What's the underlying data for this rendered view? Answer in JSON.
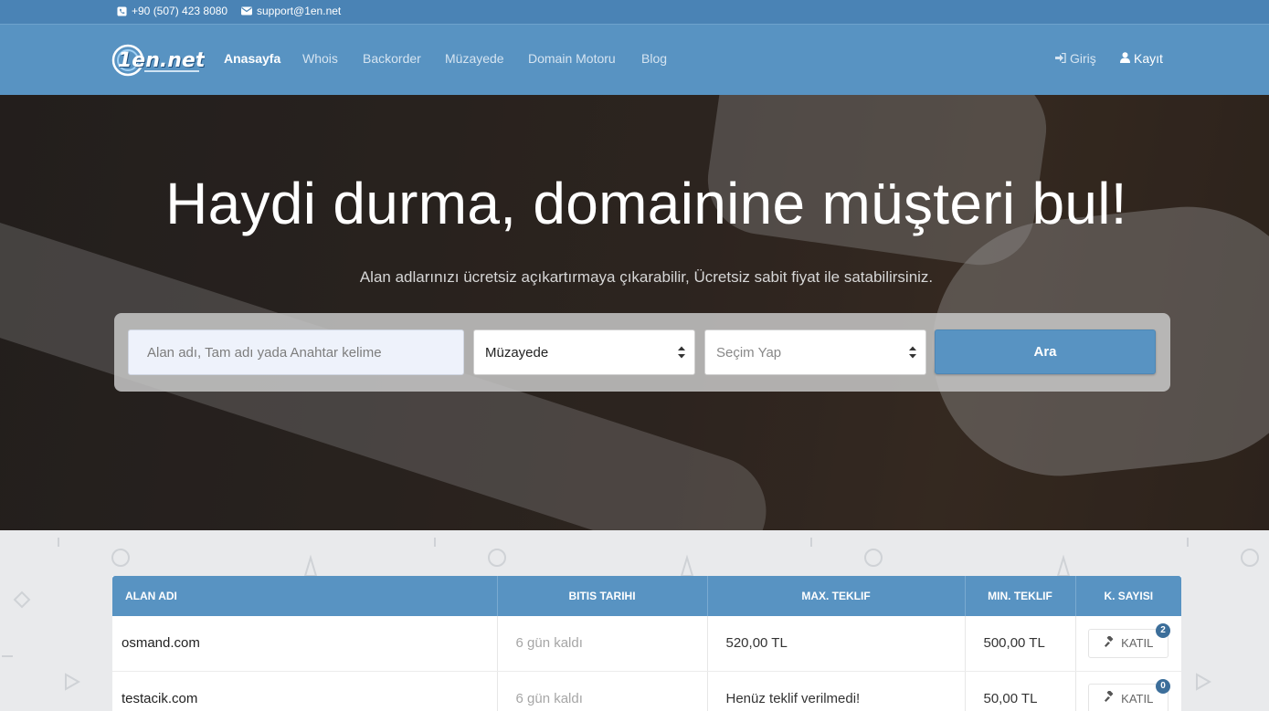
{
  "topbar": {
    "phone": "+90 (507) 423 8080",
    "email": "support@1en.net"
  },
  "nav": {
    "logo_text": "1en.net",
    "items": [
      "Anasayfa",
      "Whois",
      "Backorder",
      "Müzayede",
      "Domain Motoru",
      "Blog"
    ],
    "login": "Giriş",
    "register": "Kayıt"
  },
  "hero": {
    "title": "Haydi durma, domainine müşteri bul!",
    "subtitle": "Alan adlarınızı ücretsiz açıkartırmaya çıkarabilir, Ücretsiz sabit fiyat ile satabilirsiniz.",
    "search_placeholder": "Alan adı, Tam adı yada Anahtar kelime",
    "select_type": "Müzayede",
    "select_option": "Seçim Yap",
    "search_button": "Ara"
  },
  "table": {
    "headers": [
      "ALAN ADI",
      "BITIS TARIHI",
      "MAX. TEKLIF",
      "MIN. TEKLIF",
      "K. SAYISI"
    ],
    "rows": [
      {
        "domain": "osmand.com",
        "end": "6 gün kaldı",
        "max": "520,00 TL",
        "min": "500,00 TL",
        "join": "KATIL",
        "count": "2"
      },
      {
        "domain": "testacik.com",
        "end": "6 gün kaldı",
        "max": "Henüz teklif verilmedi!",
        "min": "50,00 TL",
        "join": "KATIL",
        "count": "0"
      }
    ]
  },
  "colors": {
    "primary": "#5893c2",
    "topbar": "#4a83b5",
    "badge": "#3c6e9a"
  },
  "icons": [
    "phone-icon",
    "envelope-icon",
    "sign-in-icon",
    "user-icon",
    "gavel-icon"
  ]
}
